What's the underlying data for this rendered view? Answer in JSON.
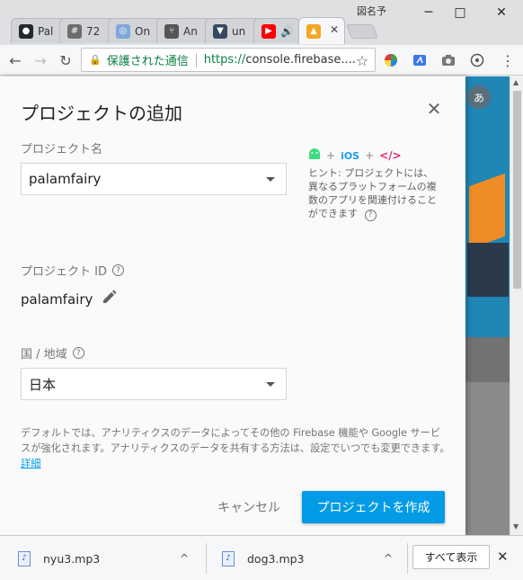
{
  "window": {
    "user_name": "図名予",
    "minimize": "─",
    "maximize": "□",
    "close": "✕"
  },
  "tabs": [
    {
      "label": "Pal",
      "icon": "github-icon",
      "color": "#24292e",
      "glyph": "●"
    },
    {
      "label": "72",
      "icon": "slack-icon",
      "color": "#6d6d6d",
      "glyph": "#"
    },
    {
      "label": "On",
      "icon": "circle-app-icon",
      "color": "#7fa7d9",
      "glyph": "◎"
    },
    {
      "label": "An",
      "icon": "branch-icon",
      "color": "#555555",
      "glyph": "⑂"
    },
    {
      "label": "un",
      "icon": "vue-icon",
      "color": "#35495e",
      "glyph": "▼"
    },
    {
      "label": "🔊",
      "icon": "youtube-icon",
      "color": "#ff0000",
      "glyph": "▶"
    },
    {
      "label": "✕",
      "icon": "firebase-icon",
      "color": "#f5a623",
      "glyph": "▲"
    }
  ],
  "toolbar": {
    "back": "←",
    "forward": "→",
    "reload": "↻",
    "lock_icon": "🔒",
    "secure_label": "保護された通信",
    "url_scheme": "https://",
    "url_rest": "console.firebase....",
    "star": "☆",
    "menu": "⋮"
  },
  "page": {
    "avatar_letter": "あ"
  },
  "dialog": {
    "title": "プロジェクトの追加",
    "close": "✕",
    "project_name_label": "プロジェクト名",
    "project_name_value": "palamfairy",
    "hint_ios": "iOS",
    "hint_web": "</>",
    "hint_plus": "+",
    "hint_text": "ヒント: プロジェクトには、異なるプラットフォームの複数のアプリを関連付けることができます",
    "help_glyph": "?",
    "project_id_label": "プロジェクト ID",
    "project_id_value": "palamfairy",
    "region_label": "国 / 地域",
    "region_value": "日本",
    "note": "デフォルトでは、アナリティクスのデータによってその他の Firebase 機能や Google サービスが強化されます。アナリティクスのデータを共有する方法は、設定でいつでも変更できます。",
    "note_link": "詳細",
    "cancel_label": "キャンセル",
    "create_label": "プロジェクトを作成"
  },
  "downloads": {
    "items": [
      {
        "name": "nyu3.mp3"
      },
      {
        "name": "dog3.mp3"
      }
    ],
    "chevron": "^",
    "show_all": "すべて表示",
    "close": "✕"
  }
}
